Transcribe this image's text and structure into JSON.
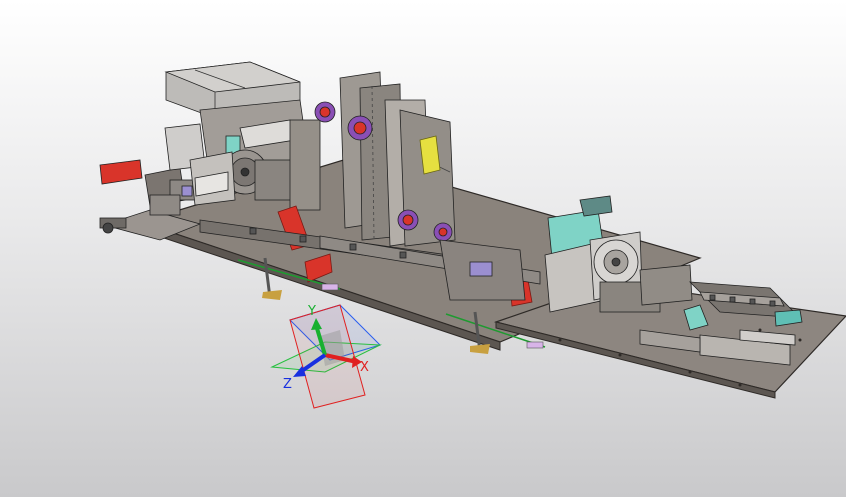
{
  "viewport": {
    "background": "gradient-gray",
    "model": "assembly-line-machine"
  },
  "triad": {
    "x_label": "X",
    "y_label": "Y",
    "z_label": "Z",
    "x_color": "#e02020",
    "y_color": "#18b030",
    "z_color": "#1830e0"
  },
  "colors": {
    "plate": "#8c857e",
    "plate_edge": "#3a3632",
    "accent_red": "#d9342a",
    "accent_teal": "#7fd3c6",
    "accent_purple": "#8a4fb5",
    "accent_yellow": "#e6e040"
  }
}
